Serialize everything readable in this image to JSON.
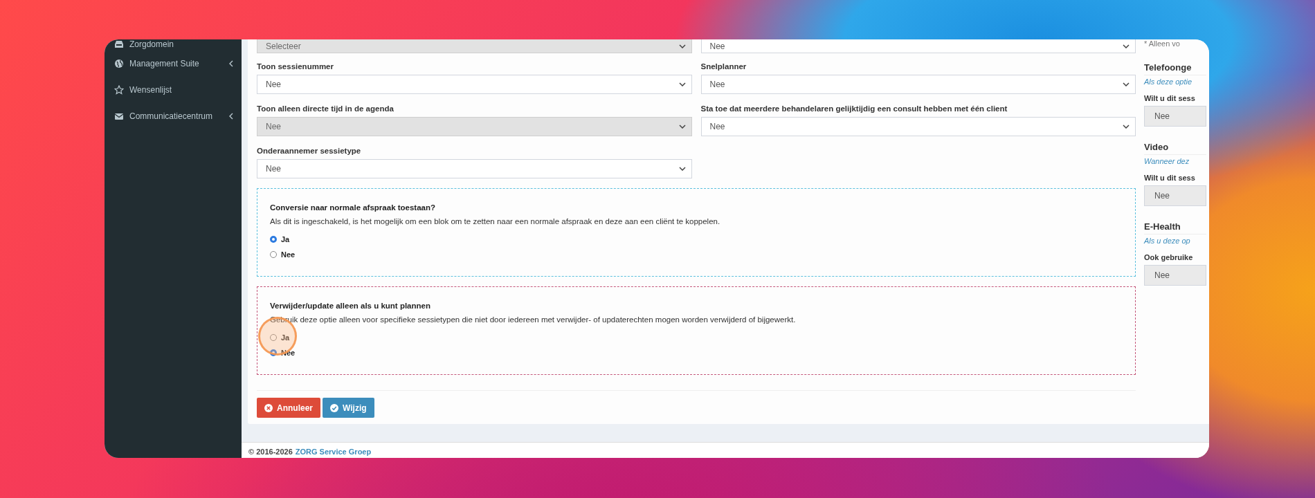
{
  "sidebar": {
    "items": [
      {
        "label": "Zorgdomein",
        "kind": "link"
      },
      {
        "label": "Management Suite",
        "kind": "submenu"
      },
      {
        "label": "Wensenlijst",
        "kind": "link"
      },
      {
        "label": "Communicatiecentrum",
        "kind": "submenu"
      }
    ]
  },
  "form": {
    "fields": [
      {
        "value": "Selecteer",
        "disabled": true
      },
      {
        "value": "Nee",
        "disabled": false
      },
      {
        "label": "Toon sessienummer",
        "value": "Nee",
        "disabled": false
      },
      {
        "label": "Snelplanner",
        "value": "Nee",
        "disabled": false
      },
      {
        "label": "Toon alleen directe tijd in de agenda",
        "value": "Nee",
        "disabled": true
      },
      {
        "label": "Sta toe dat meerdere behandelaren gelijktijdig een consult hebben met één client",
        "value": "Nee",
        "disabled": false
      },
      {
        "label": "Onderaannemer sessietype",
        "value": "Nee",
        "disabled": false
      }
    ],
    "option_groups": [
      {
        "title": "Conversie naar normale afspraak toestaan?",
        "description": "Als dit is ingeschakeld, is het mogelijk om een blok om te zetten naar een normale afspraak en deze aan een cliënt te koppelen.",
        "color": "#5bc0de",
        "options": [
          {
            "label": "Ja",
            "selected": true
          },
          {
            "label": "Nee",
            "selected": false
          }
        ]
      },
      {
        "title": "Verwijder/update alleen als u kunt plannen",
        "description": "Gebruik deze optie alleen voor specifieke sessietypen die niet door iedereen met verwijder- of updaterechten mogen worden verwijderd of bijgewerkt.",
        "color": "#c4567a",
        "options": [
          {
            "label": "Ja",
            "selected": false
          },
          {
            "label": "Nee",
            "selected": true
          }
        ]
      }
    ],
    "buttons": [
      {
        "label": "Annuleer",
        "kind": "cancel"
      },
      {
        "label": "Wijzig",
        "kind": "submit"
      }
    ]
  },
  "aside": {
    "note": "* Alleen vo",
    "sections": [
      {
        "heading": "Telefoonge",
        "hint": "Als deze optie",
        "question": "Wilt u dit sess",
        "value": "Nee"
      },
      {
        "heading": "Video",
        "hint": "Wanneer dez",
        "question": "Wilt u dit sess",
        "value": "Nee"
      },
      {
        "heading": "E-Health",
        "hint": "Als u deze op",
        "question": "Ook gebruike",
        "value": "Nee"
      }
    ]
  },
  "footer": {
    "copyright": "© 2016-2026",
    "link": "ZORG Service Groep"
  }
}
